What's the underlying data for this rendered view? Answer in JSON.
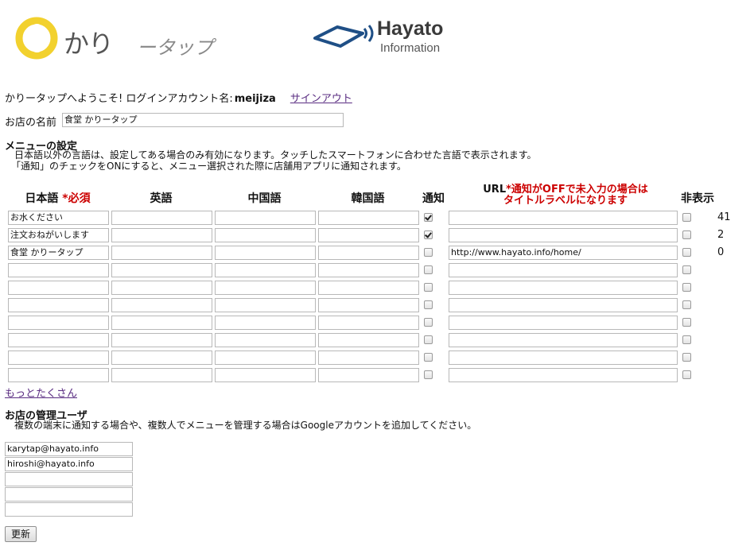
{
  "logos": {
    "kari_text": "かり",
    "tappu_text": "ータップ",
    "hayato_brand": "Hayato",
    "hayato_sub": "Information"
  },
  "header": {
    "welcome": "かりータップへようこそ! ログインアカウント名:",
    "account": "meijiza",
    "signout": "サインアウト"
  },
  "shop": {
    "label": "お店の名前",
    "value": "食堂 かりータップ"
  },
  "menu_settings": {
    "title": "メニューの設定",
    "desc1": "日本語以外の言語は、設定してある場合のみ有効になります。タッチしたスマートフォンに合わせた言語で表示されます。",
    "desc2": "「通知」のチェックをONにすると、メニュー選択された際に店舗用アプリに通知されます。"
  },
  "table": {
    "headers": {
      "ja": "日本語",
      "required": "*必須",
      "en": "英語",
      "zh": "中国語",
      "ko": "韓国語",
      "notify": "通知",
      "url": "URL",
      "url_note_1": "*通知がOFFで未入力の場合は",
      "url_note_2": "タイトルラベルになります",
      "hide": "非表示"
    },
    "rows": [
      {
        "ja": "お水ください",
        "en": "",
        "zh": "",
        "ko": "",
        "notify": true,
        "url": "",
        "hidden": false,
        "count": "41"
      },
      {
        "ja": "注文おねがいします",
        "en": "",
        "zh": "",
        "ko": "",
        "notify": true,
        "url": "",
        "hidden": false,
        "count": "2"
      },
      {
        "ja": "食堂 かりータップ",
        "en": "",
        "zh": "",
        "ko": "",
        "notify": false,
        "url": "http://www.hayato.info/home/",
        "hidden": false,
        "count": "0"
      },
      {
        "ja": "",
        "en": "",
        "zh": "",
        "ko": "",
        "notify": false,
        "url": "",
        "hidden": false,
        "count": ""
      },
      {
        "ja": "",
        "en": "",
        "zh": "",
        "ko": "",
        "notify": false,
        "url": "",
        "hidden": false,
        "count": ""
      },
      {
        "ja": "",
        "en": "",
        "zh": "",
        "ko": "",
        "notify": false,
        "url": "",
        "hidden": false,
        "count": ""
      },
      {
        "ja": "",
        "en": "",
        "zh": "",
        "ko": "",
        "notify": false,
        "url": "",
        "hidden": false,
        "count": ""
      },
      {
        "ja": "",
        "en": "",
        "zh": "",
        "ko": "",
        "notify": false,
        "url": "",
        "hidden": false,
        "count": ""
      },
      {
        "ja": "",
        "en": "",
        "zh": "",
        "ko": "",
        "notify": false,
        "url": "",
        "hidden": false,
        "count": ""
      },
      {
        "ja": "",
        "en": "",
        "zh": "",
        "ko": "",
        "notify": false,
        "url": "",
        "hidden": false,
        "count": ""
      }
    ],
    "more_link": "もっとたくさん"
  },
  "admin": {
    "title": "お店の管理ユーザ",
    "desc": "複数の端末に通知する場合や、複数人でメニューを管理する場合はGoogleアカウントを追加してください。",
    "users": [
      "karytap@hayato.info",
      "hiroshi@hayato.info",
      "",
      "",
      ""
    ]
  },
  "buttons": {
    "update": "更新"
  },
  "colors": {
    "required": "#cc0000",
    "link": "#5a2d82",
    "logo_yellow": "#f2d12e",
    "logo_blue": "#1f4f86"
  }
}
